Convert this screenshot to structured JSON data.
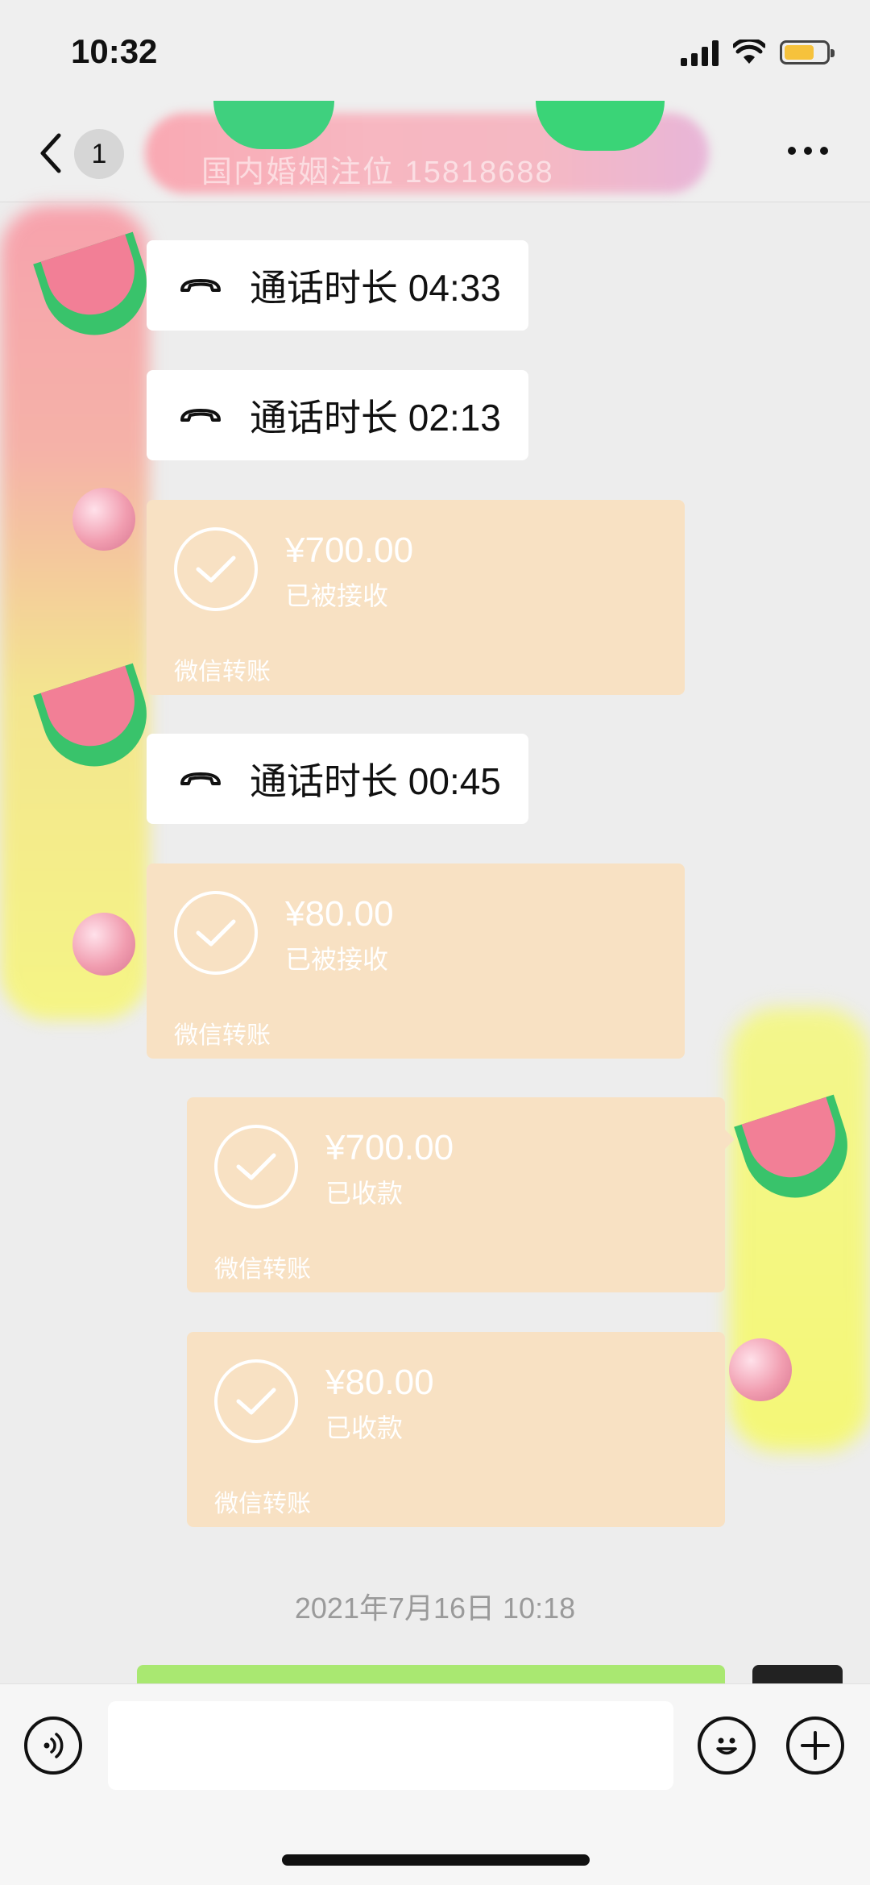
{
  "status_bar": {
    "time": "10:32",
    "battery_level": 0.7
  },
  "nav": {
    "unread_count": "1",
    "title": "国内婚姻注位 15818688"
  },
  "messages": [
    {
      "type": "call",
      "side": "left",
      "text": "通话时长 04:33"
    },
    {
      "type": "call",
      "side": "left",
      "text": "通话时长 02:13"
    },
    {
      "type": "transfer",
      "side": "left",
      "amount": "¥700.00",
      "status": "已被接收",
      "label": "微信转账"
    },
    {
      "type": "call",
      "side": "left",
      "text": "通话时长 00:45"
    },
    {
      "type": "transfer",
      "side": "left",
      "amount": "¥80.00",
      "status": "已被接收",
      "label": "微信转账"
    },
    {
      "type": "transfer",
      "side": "right",
      "amount": "¥700.00",
      "status": "已收款",
      "label": "微信转账"
    },
    {
      "type": "transfer",
      "side": "right",
      "amount": "¥80.00",
      "status": "已收款",
      "label": "微信转账"
    }
  ],
  "timestamp": "2021年7月16日 10:18",
  "input_bar": {
    "placeholder": ""
  },
  "colors": {
    "transfer_bg": "#f8e1c3",
    "chat_bg": "#ededed",
    "sent_bubble": "#a9e871"
  }
}
